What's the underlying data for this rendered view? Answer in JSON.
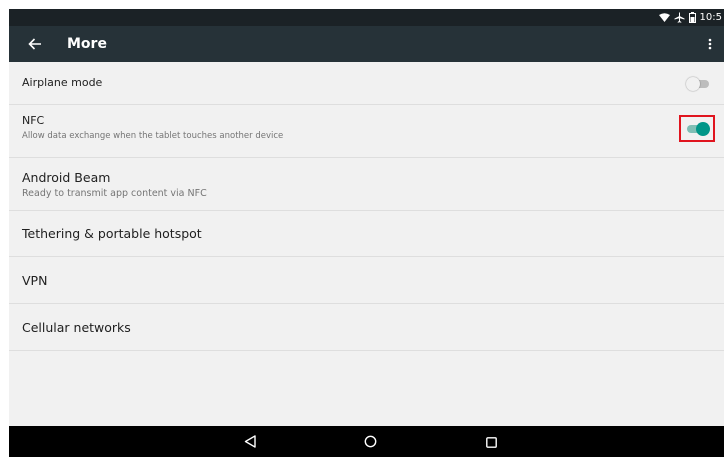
{
  "status_bar": {
    "time": "10:5",
    "icons": [
      "wifi-icon",
      "airplane-icon",
      "battery-icon"
    ]
  },
  "toolbar": {
    "back_icon": "arrow-back-icon",
    "title": "More",
    "overflow_icon": "more-vert-icon"
  },
  "settings": {
    "airplane": {
      "title": "Airplane mode",
      "enabled": false
    },
    "nfc": {
      "title": "NFC",
      "summary": "Allow data exchange when the tablet touches another device",
      "enabled": true
    },
    "beam": {
      "title": "Android Beam",
      "summary": "Ready to transmit app content via NFC"
    },
    "tethering": {
      "title": "Tethering & portable hotspot"
    },
    "vpn": {
      "title": "VPN"
    },
    "cellular": {
      "title": "Cellular networks"
    }
  },
  "nav_bar": {
    "icons": [
      "nav-back-icon",
      "nav-home-icon",
      "nav-recents-icon"
    ]
  },
  "colors": {
    "status_bar": "#1b2226",
    "toolbar": "#263238",
    "accent": "#009688",
    "highlight": "#e0141e",
    "background": "#f1f1f1"
  }
}
